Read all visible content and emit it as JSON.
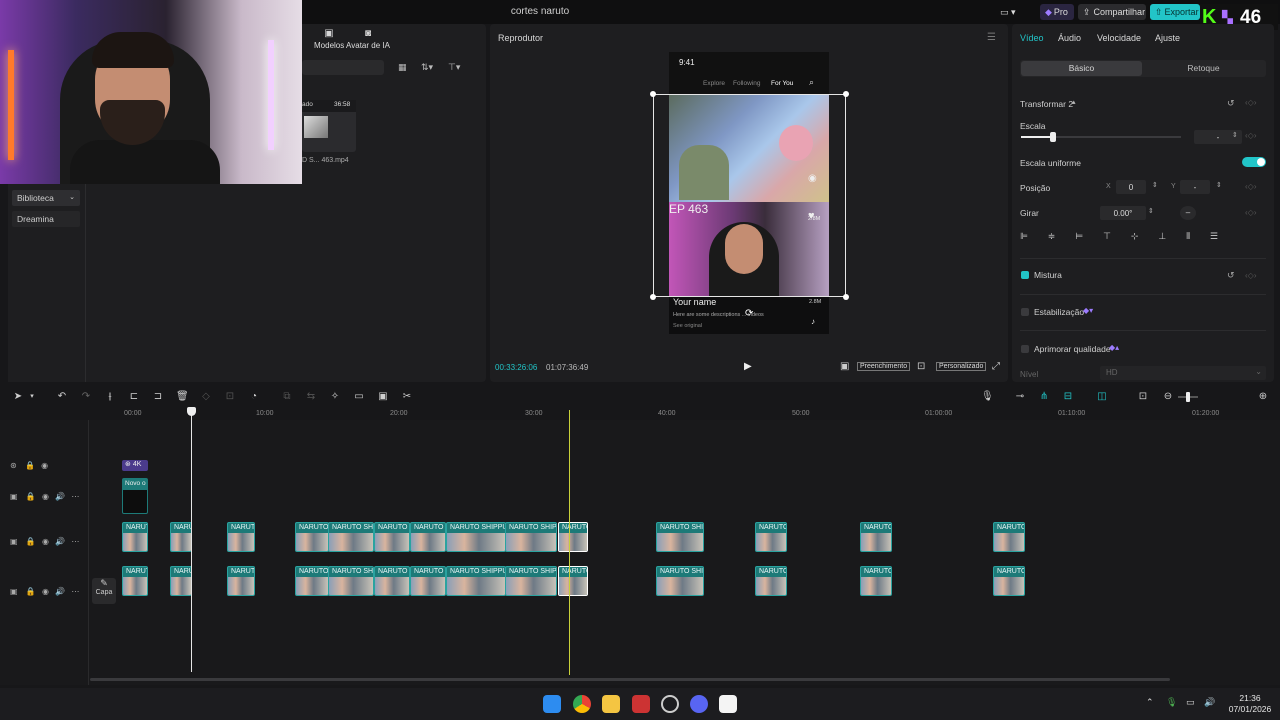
{
  "app": {
    "title": "cortes naruto"
  },
  "header": {
    "pro_label": "Pro",
    "share_label": "Compartilhar",
    "export_label": "Exportar"
  },
  "stream": {
    "viewer_count": "46"
  },
  "top_tabs": [
    {
      "label": "Modelos"
    },
    {
      "label": "Avatar de IA"
    }
  ],
  "media": {
    "thumb_duration": "36:58",
    "thumb_filename": "D S... 463.mp4",
    "thumb_prefix": "ado"
  },
  "sidebar": {
    "items": [
      {
        "label": "Biblioteca"
      },
      {
        "label": "Dreamina"
      }
    ]
  },
  "player": {
    "title": "Reprodutor",
    "current_time": "00:33:26:06",
    "total_time": "01:07:36:49",
    "fill_label": "Preenchimento",
    "custom_label": "Personalizado",
    "phone": {
      "status_time": "9:41",
      "tabs": [
        "Explore",
        "Following",
        "For You"
      ],
      "episode": "EP 463",
      "likes": "2.8M",
      "shares": "2.8M",
      "name": "Your name",
      "desc": "Here are some descriptions ... videos",
      "see_original": "See original"
    }
  },
  "inspector": {
    "tabs": [
      {
        "label": "Vídeo",
        "active": true
      },
      {
        "label": "Áudio"
      },
      {
        "label": "Velocidade"
      },
      {
        "label": "Ajuste"
      }
    ],
    "segments": [
      "Básico",
      "Retoque"
    ],
    "transform_label": "Transformar 2",
    "scale_label": "Escala",
    "scale_value": "-",
    "uniform_label": "Escala uniforme",
    "position_label": "Posição",
    "x_label": "X",
    "x_value": "0",
    "y_label": "Y",
    "y_value": "-",
    "rotate_label": "Girar",
    "rotate_value": "0.00°",
    "blend_label": "Mistura",
    "stabilize_label": "Estabilização",
    "enhance_label": "Aprimorar qualidade",
    "level_label": "Nível",
    "level_value": "HD",
    "accent": "#22c5c8"
  },
  "timeline": {
    "ruler": [
      "00:00",
      "10:00",
      "20:00",
      "30:00",
      "40:00",
      "50:00",
      "01:00:00",
      "01:10:00",
      "01:20:00"
    ],
    "sticker_label": "4K",
    "text_clip_label": "Novo o",
    "cover_label": "Capa",
    "clip_labels": [
      "NARUTO",
      "NARUT",
      "NARUTO",
      "NARUTO",
      "NARUTO SHIP",
      "NARUTO S",
      "NARUTO S",
      "NARUTO SHIPPUD",
      "NARUTO SHIPP",
      "NARUTO",
      "NARUTO SHIPI",
      "NARUTO",
      "NARUTO S",
      "NARUTO"
    ]
  },
  "taskbar": {
    "time": "21:36",
    "date": "07/01/2026"
  }
}
